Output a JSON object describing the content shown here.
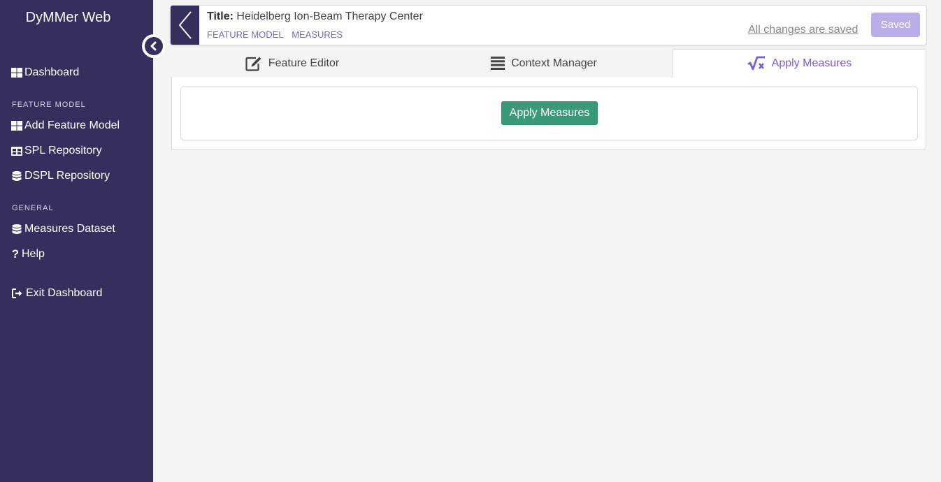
{
  "sidebar": {
    "brand": "DyMMer Web",
    "dashboard": "Dashboard",
    "section_feature_model": "FEATURE MODEL",
    "add_feature_model": "Add Feature Model",
    "spl_repository": "SPL Repository",
    "dspl_repository": "DSPL Repository",
    "section_general": "GENERAL",
    "measures_dataset": "Measures Dataset",
    "help": "Help",
    "exit_dashboard": "Exit Dashboard",
    "bg_color": "#33305e"
  },
  "header": {
    "title_label": "Title:",
    "title_value": "Heidelberg Ion-Beam Therapy Center",
    "crumbs": [
      "FEATURE MODEL",
      "MEASURES"
    ],
    "save_status": "All changes are saved",
    "saved_button": "Saved"
  },
  "tabs": [
    {
      "label": "Feature Editor",
      "icon": "edit-icon",
      "active": false
    },
    {
      "label": "Context Manager",
      "icon": "list-icon",
      "active": false
    },
    {
      "label": "Apply Measures",
      "icon": "square-root-icon",
      "active": true
    }
  ],
  "main": {
    "apply_button": "Apply Measures"
  },
  "colors": {
    "accent": "#7b5fd0",
    "button_green": "#3a9a78",
    "saved_button": "#b9aee8"
  }
}
